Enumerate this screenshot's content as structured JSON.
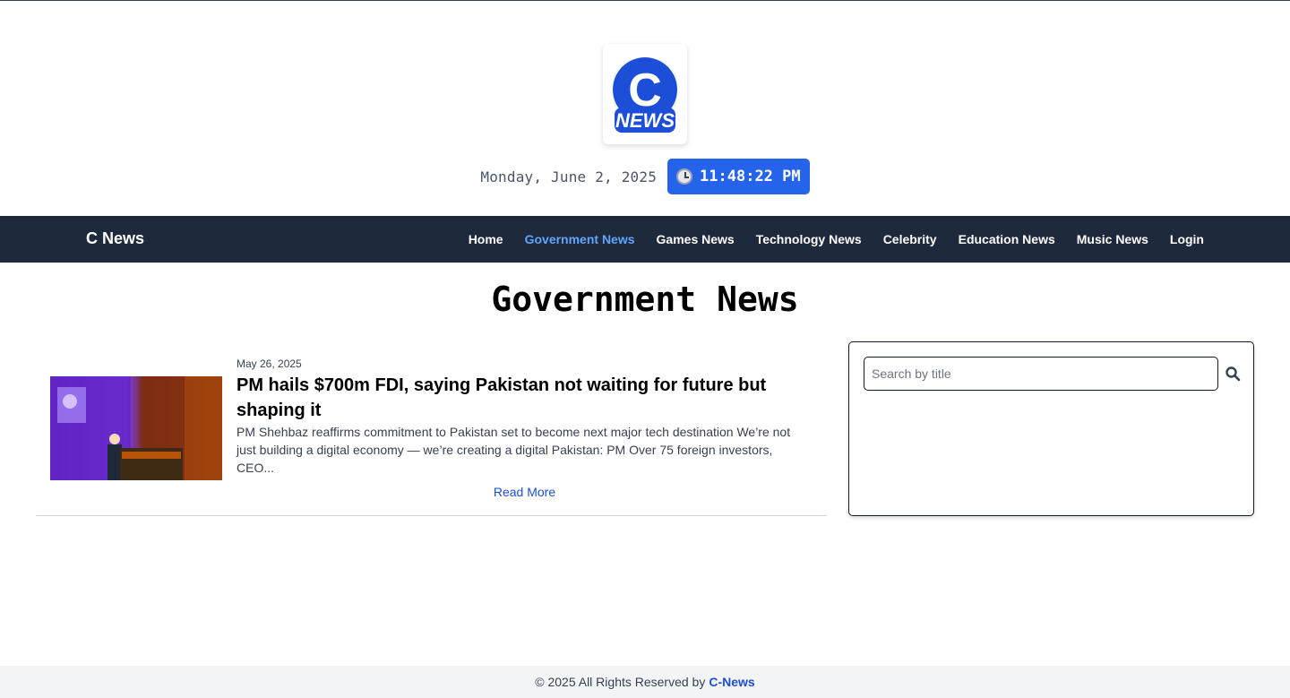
{
  "header": {
    "logo_letter": "C",
    "logo_text": "NEWS",
    "date": "Monday, June 2, 2025",
    "time": "11:48:22 PM"
  },
  "nav": {
    "brand": "C News",
    "links": [
      {
        "label": "Home",
        "active": false
      },
      {
        "label": "Government News",
        "active": true
      },
      {
        "label": "Games News",
        "active": false
      },
      {
        "label": "Technology News",
        "active": false
      },
      {
        "label": "Celebrity",
        "active": false
      },
      {
        "label": "Education News",
        "active": false
      },
      {
        "label": "Music News",
        "active": false
      },
      {
        "label": "Login",
        "active": false
      }
    ]
  },
  "main": {
    "page_title": "Government News",
    "articles": [
      {
        "date": "May 26, 2025",
        "title": "PM hails $700m FDI, saying Pakistan not waiting for future but shaping it",
        "excerpt": "PM Shehbaz reaffirms commitment to Pakistan set to become next major tech destination We’re not just building a digital economy — we’re creating a digital Pakistan: PM Over 75 foreign investors, CEO...",
        "read_more": "Read More"
      }
    ]
  },
  "sidebar": {
    "search_placeholder": "Search by title",
    "search_value": ""
  },
  "footer": {
    "text": "© 2025 All Rights Reserved by",
    "brand": "C-News"
  },
  "colors": {
    "accent": "#2563eb",
    "nav_bg": "#1e293b",
    "nav_active": "#60a5fa",
    "logo_blue": "#1d4ed8"
  }
}
